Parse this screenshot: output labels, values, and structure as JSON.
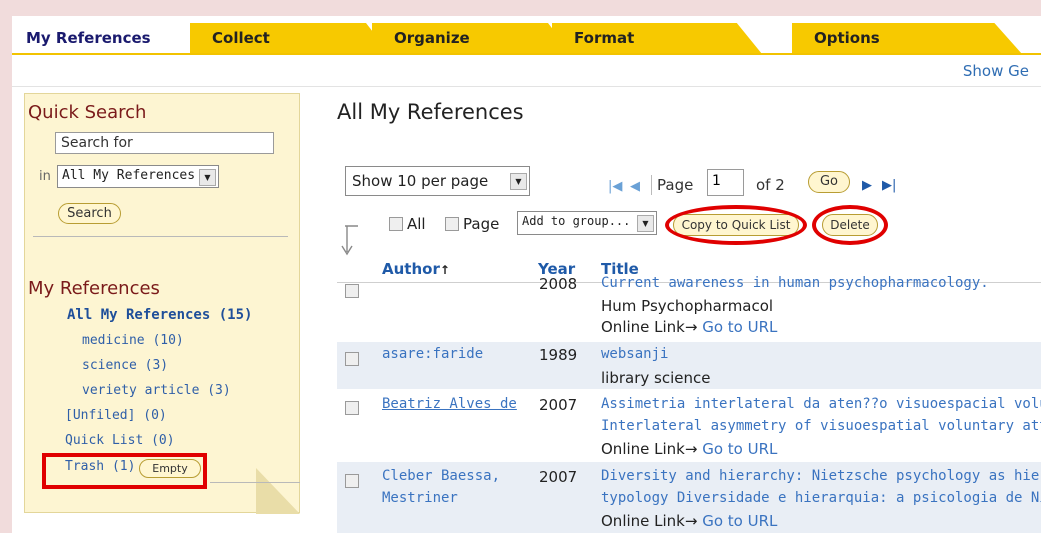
{
  "tabs": [
    {
      "label": "My References"
    },
    {
      "label": "Collect"
    },
    {
      "label": "Organize"
    },
    {
      "label": "Format"
    },
    {
      "label": "Options"
    }
  ],
  "header_link": "Show Ge",
  "sidebar": {
    "quick_search_title": "Quick Search",
    "search_placeholder": "Search for",
    "in_label": "in",
    "scope_select": "All My References",
    "search_button": "Search",
    "my_refs_title": "My References",
    "all_refs": "All My References (15)",
    "groups": [
      "medicine (10)",
      "science (3)",
      "veriety article (3)"
    ],
    "unfiled": "[Unfiled] (0)",
    "quick_list": "Quick List (0)",
    "trash": "Trash (1)",
    "empty_button": "Empty"
  },
  "main": {
    "title": "All My References",
    "per_page": "Show 10 per page",
    "page_label": "Page",
    "page_value": "1",
    "of_label": "of 2",
    "go_button": "Go",
    "all_label": "All",
    "page_check_label": "Page",
    "add_group": "Add to group...",
    "copy_button": "Copy to Quick List",
    "delete_button": "Delete",
    "columns": [
      "Author",
      "Year",
      "Title"
    ],
    "rows": [
      {
        "author": "",
        "year": "2008",
        "title": "Current awareness in human psychopharmacology.",
        "line2": "Hum Psychopharmacol",
        "link_prefix": "Online Link",
        "link_text": "Go to URL"
      },
      {
        "author": "asare:faride",
        "year": "1989",
        "title": "websanji",
        "line2": "library science"
      },
      {
        "author": "Beatriz Alves de",
        "year": "2007",
        "title": "Assimetria interlateral da aten??o visuoespacial volur",
        "title2": "Interlateral asymmetry of visuoespatial voluntary att",
        "link_prefix": "Online Link",
        "link_text": "Go to URL"
      },
      {
        "author": "Cleber Baessa,",
        "author2": "Mestriner",
        "year": "2007",
        "title": "Diversity and hierarchy: Nietzsche psychology as hie",
        "title2": "typology Diversidade e hierarquia: a psicologia de Ni",
        "link_prefix": "Online Link",
        "link_text": "Go to URL"
      }
    ]
  }
}
